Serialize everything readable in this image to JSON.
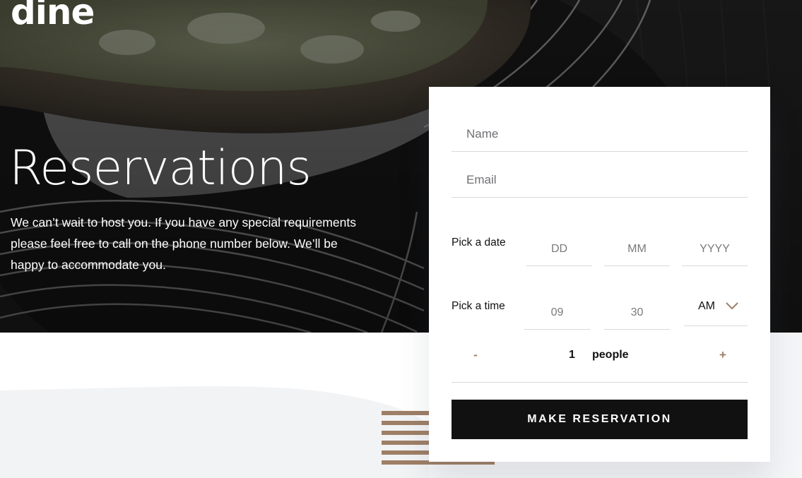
{
  "brand": {
    "logo": "dine"
  },
  "hero": {
    "title": "Reservations",
    "text": "We can’t wait to host you. If you have any special requirements please feel free to call on the phone number below. We’ll be happy to accommodate you."
  },
  "form": {
    "name": {
      "placeholder": "Name"
    },
    "email": {
      "placeholder": "Email"
    },
    "date": {
      "label": "Pick a date",
      "day_placeholder": "DD",
      "month_placeholder": "MM",
      "year_placeholder": "YYYY"
    },
    "time": {
      "label": "Pick a time",
      "hour_placeholder": "09",
      "minute_placeholder": "30",
      "period": "AM"
    },
    "people": {
      "decrement_label": "-",
      "count": "1",
      "unit": "people",
      "increment_label": "+"
    },
    "submit_label": "MAKE RESERVATION"
  },
  "colors": {
    "accent": "#9e7f66",
    "dark": "#111111",
    "light_gray": "#f2f3f5"
  },
  "icons": {
    "select": "chevron-down-icon"
  }
}
